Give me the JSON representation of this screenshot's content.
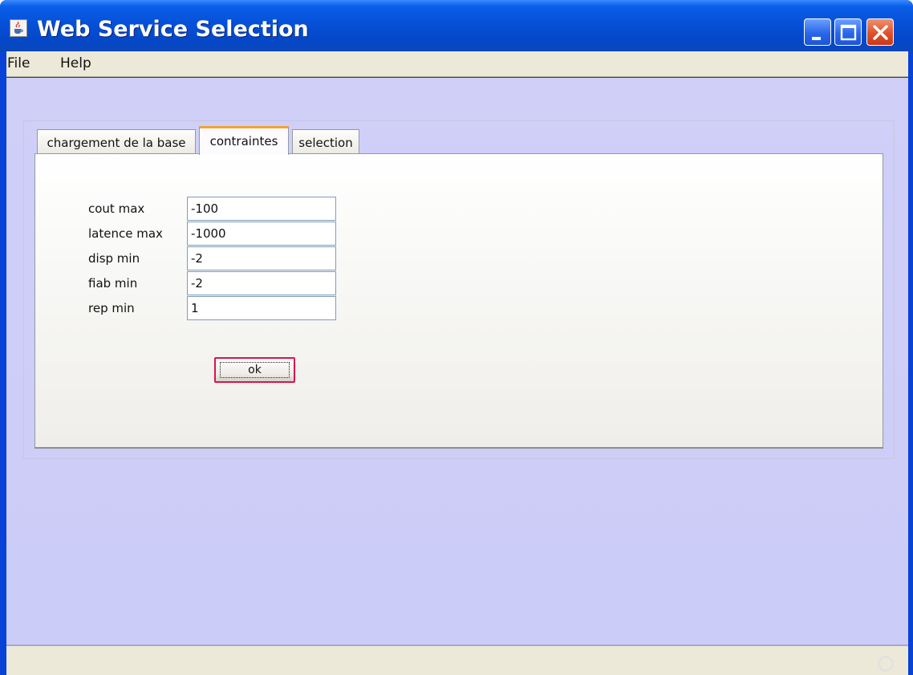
{
  "window": {
    "title": "Web Service Selection"
  },
  "menu": {
    "file": "File",
    "help": "Help"
  },
  "tabs": [
    {
      "label": "chargement de la base",
      "selected": false
    },
    {
      "label": "contraintes",
      "selected": true
    },
    {
      "label": "selection",
      "selected": false
    }
  ],
  "form": {
    "fields": [
      {
        "label": "cout max",
        "value": "-100"
      },
      {
        "label": "latence max",
        "value": "-1000"
      },
      {
        "label": "disp min",
        "value": "-2"
      },
      {
        "label": "fiab min",
        "value": "-2"
      },
      {
        "label": "rep min",
        "value": "1"
      }
    ],
    "ok_label": "ok"
  },
  "colors": {
    "title_bar": "#0650d8",
    "content_background": "#ccccf8",
    "selected_tab_accent": "#f2a232",
    "ok_focus_border": "#d8154e"
  },
  "icons": {
    "app": "java-cup-icon",
    "minimize": "minimize-icon",
    "maximize": "maximize-icon",
    "close": "close-icon",
    "resize": "resize-grip-icon"
  }
}
